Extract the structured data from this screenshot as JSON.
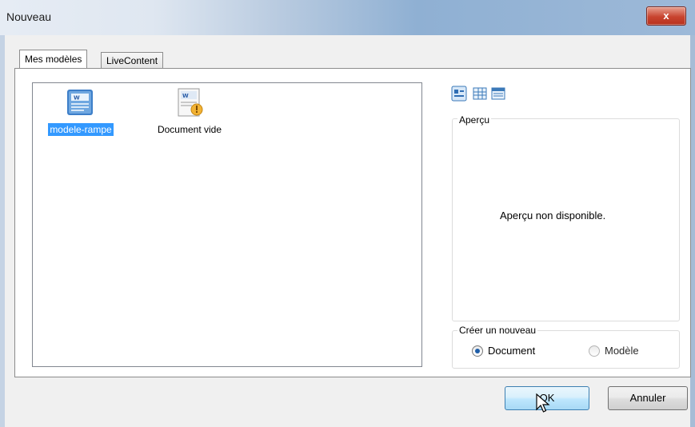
{
  "window": {
    "title": "Nouveau",
    "close_label": "x"
  },
  "tabs": [
    {
      "label": "Mes modèles",
      "active": true
    },
    {
      "label": "LiveContent",
      "active": false
    }
  ],
  "files": [
    {
      "label": "modele-rampe",
      "icon": "word-template-icon",
      "selected": true
    },
    {
      "label": "Document vide",
      "icon": "word-document-wizard-icon",
      "selected": false
    }
  ],
  "view_buttons": [
    "large-icons-view-icon",
    "list-view-icon",
    "details-view-icon"
  ],
  "preview": {
    "legend": "Aperçu",
    "message": "Aperçu non disponible."
  },
  "create_new": {
    "legend": "Créer un nouveau",
    "options": [
      {
        "label": "Document",
        "checked": true
      },
      {
        "label": "Modèle",
        "checked": false
      }
    ]
  },
  "buttons": {
    "ok": "OK",
    "cancel": "Annuler"
  },
  "colors": {
    "selection": "#3399ff",
    "close": "#c8442f"
  }
}
